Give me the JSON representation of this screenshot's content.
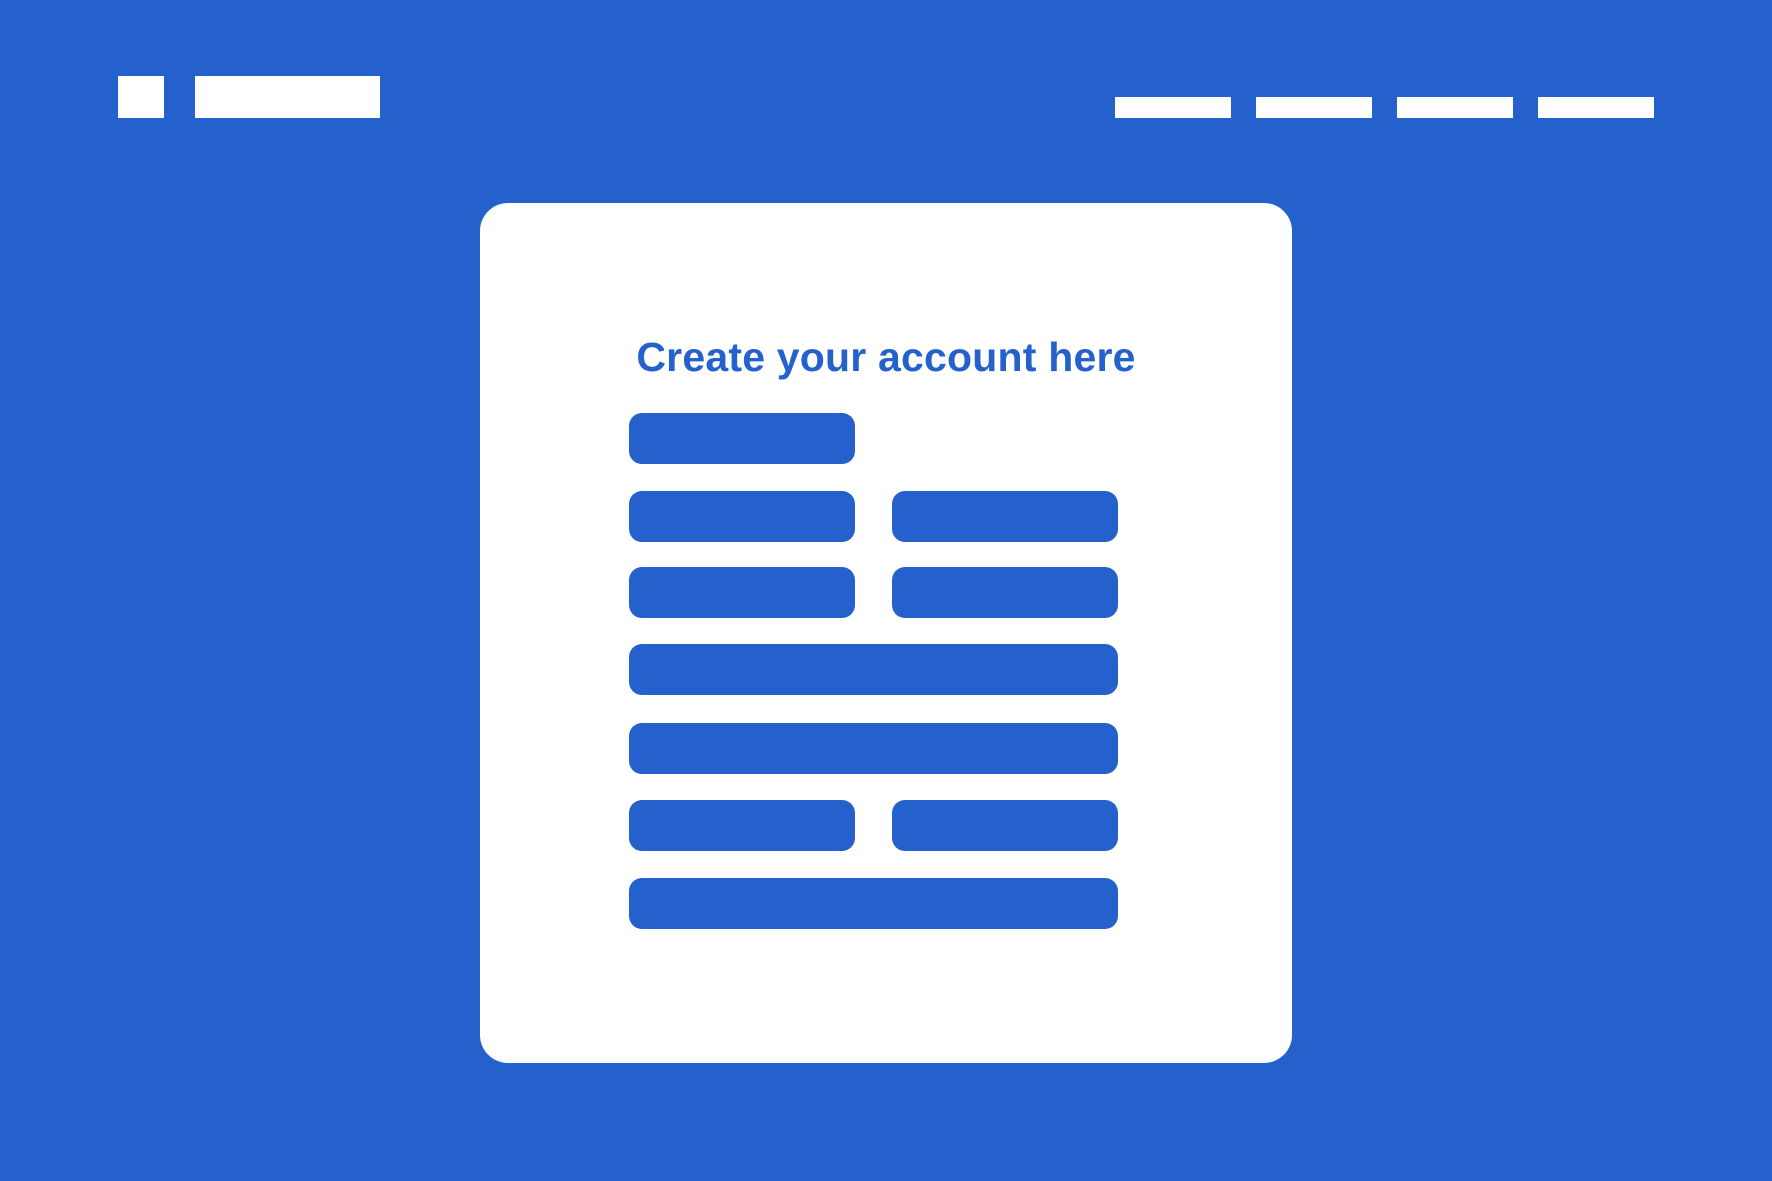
{
  "header": {
    "logo_icon": "logo-square-icon",
    "nav_items": [
      {
        "name": "nav-link-1"
      },
      {
        "name": "nav-link-2"
      },
      {
        "name": "nav-link-3"
      },
      {
        "name": "nav-link-4"
      }
    ]
  },
  "form": {
    "title": "Create your account here"
  },
  "colors": {
    "background": "#2561cd",
    "card": "#ffffff",
    "accent": "#2561cd"
  }
}
